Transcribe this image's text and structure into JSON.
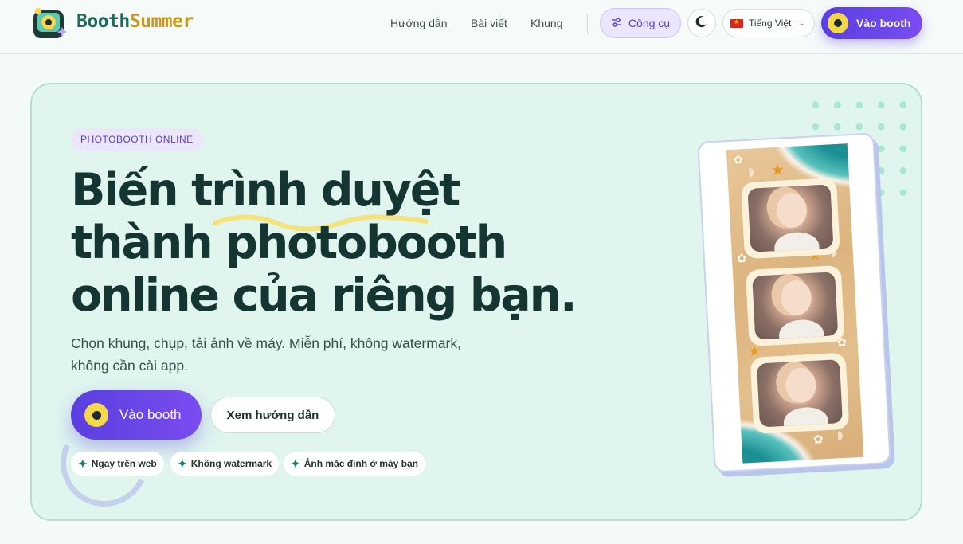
{
  "header": {
    "brand_part1": "Booth",
    "brand_part2": "Summer",
    "nav": [
      "Hướng dẫn",
      "Bài viết",
      "Khung"
    ],
    "tools_label": "Công cụ",
    "language_label": "Tiếng Việt",
    "booth_label": "Vào booth"
  },
  "hero": {
    "pill": "PHOTOBOOTH ONLINE",
    "headline_lines": [
      "Biến trình duyệt",
      "thành photobooth",
      "online của riêng bạn."
    ],
    "subtitle": "Chọn khung, chụp, tải ảnh về máy. Miễn phí, không watermark, không cần cài app.",
    "cta_primary": "Vào booth",
    "cta_secondary": "Xem hướng dẫn",
    "badges": [
      "Ngay trên web",
      "Không watermark",
      "Ảnh mặc định ở máy bạn"
    ]
  },
  "colors": {
    "accent_purple": "#5a3fe0",
    "hero_bg": "#dff5ee",
    "headline": "#143531",
    "brand_green": "#1d6b5c",
    "brand_gold": "#c99a1f"
  },
  "icons": {
    "logo": "camera-logo-icon",
    "tools": "sliders-icon",
    "theme": "moon-icon",
    "flag": "vietnam-flag-icon",
    "lens": "camera-lens-icon",
    "spark": "sparkle-icon"
  }
}
